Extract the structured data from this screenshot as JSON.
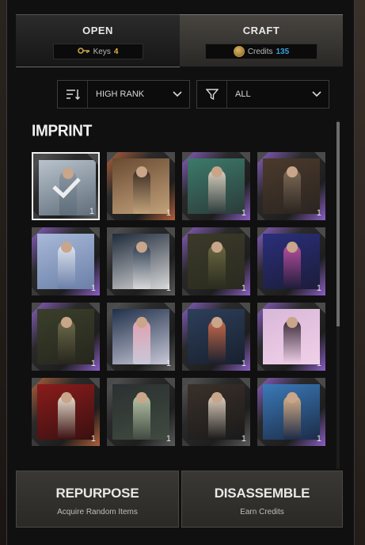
{
  "tabs": {
    "open": {
      "label": "OPEN",
      "resource_label": "Keys",
      "resource_count": "4",
      "icon": "key-icon"
    },
    "craft": {
      "label": "CRAFT",
      "resource_label": "Credits",
      "resource_count": "135",
      "icon": "credits-coin-icon"
    }
  },
  "filters": {
    "sort": {
      "value": "HIGH RANK",
      "icon": "sort-icon"
    },
    "type": {
      "value": "ALL",
      "icon": "filter-funnel-icon"
    }
  },
  "section_title": "IMPRINT",
  "items": [
    {
      "count": "1",
      "rarity": "common",
      "selected": true
    },
    {
      "count": "1",
      "rarity": "rare"
    },
    {
      "count": "1",
      "rarity": "epic"
    },
    {
      "count": "1",
      "rarity": "epic"
    },
    {
      "count": "1",
      "rarity": "epic"
    },
    {
      "count": "1",
      "rarity": "common"
    },
    {
      "count": "1",
      "rarity": "epic"
    },
    {
      "count": "1",
      "rarity": "epic"
    },
    {
      "count": "1",
      "rarity": "epic"
    },
    {
      "count": "1",
      "rarity": "common"
    },
    {
      "count": "1",
      "rarity": "epic"
    },
    {
      "count": "1",
      "rarity": "epic"
    },
    {
      "count": "1",
      "rarity": "rare"
    },
    {
      "count": "1",
      "rarity": "common"
    },
    {
      "count": "1",
      "rarity": "common"
    },
    {
      "count": "1",
      "rarity": "epic"
    }
  ],
  "colors": {
    "keys_accent": "#e3b23c",
    "credits_accent": "#3aa0d8",
    "rarity_epic": "#8a5fc4",
    "rarity_rare": "#b0603a",
    "rarity_common": "#5a5a5a"
  },
  "actions": {
    "repurpose": {
      "label": "REPURPOSE",
      "sub": "Acquire Random Items"
    },
    "disassemble": {
      "label": "DISASSEMBLE",
      "sub": "Earn Credits"
    }
  }
}
